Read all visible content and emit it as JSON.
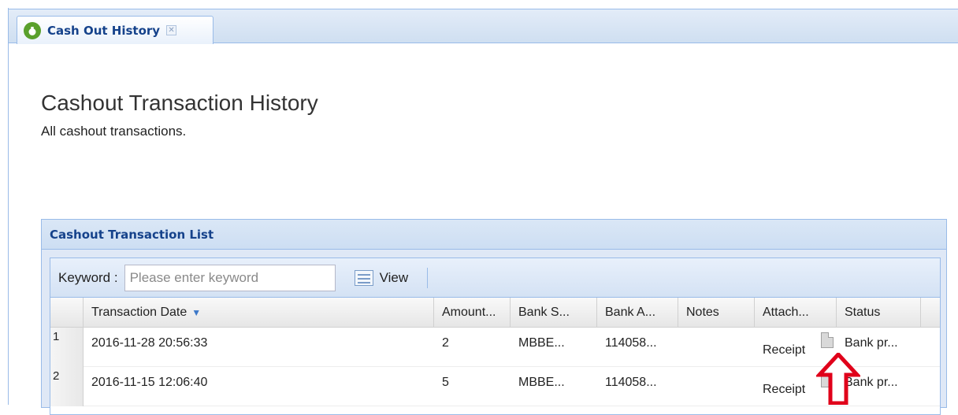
{
  "tab": {
    "label": "Cash Out History",
    "close_symbol": "✕",
    "icon": "money-bag-icon"
  },
  "page": {
    "title": "Cashout Transaction History",
    "description": "All cashout transactions."
  },
  "panel": {
    "title": "Cashout Transaction List"
  },
  "toolbar": {
    "keyword_label": "Keyword :",
    "keyword_placeholder": "Please enter keyword",
    "keyword_value": "",
    "view_label": "View"
  },
  "grid": {
    "columns": [
      "Transaction Date",
      "Amount...",
      "Bank S...",
      "Bank A...",
      "Notes",
      "Attach...",
      "Status"
    ],
    "sorted_column": "Transaction Date",
    "sort_direction": "descending",
    "rows": [
      {
        "num": "1",
        "date": "2016-11-28 20:56:33",
        "amount": "2",
        "bank_s": "MBBE...",
        "bank_a": "114058...",
        "notes": "",
        "attach": "Receipt",
        "status": "Bank pr..."
      },
      {
        "num": "2",
        "date": "2016-11-15 12:06:40",
        "amount": "5",
        "bank_s": "MBBE...",
        "bank_a": "114058...",
        "notes": "",
        "attach": "Receipt",
        "status": "Bank pr..."
      }
    ]
  },
  "colors": {
    "header_text": "#15428b",
    "border_blue": "#99bbe8",
    "annotation_arrow": "#e0001a",
    "tab_icon_green": "#5aa02c"
  }
}
